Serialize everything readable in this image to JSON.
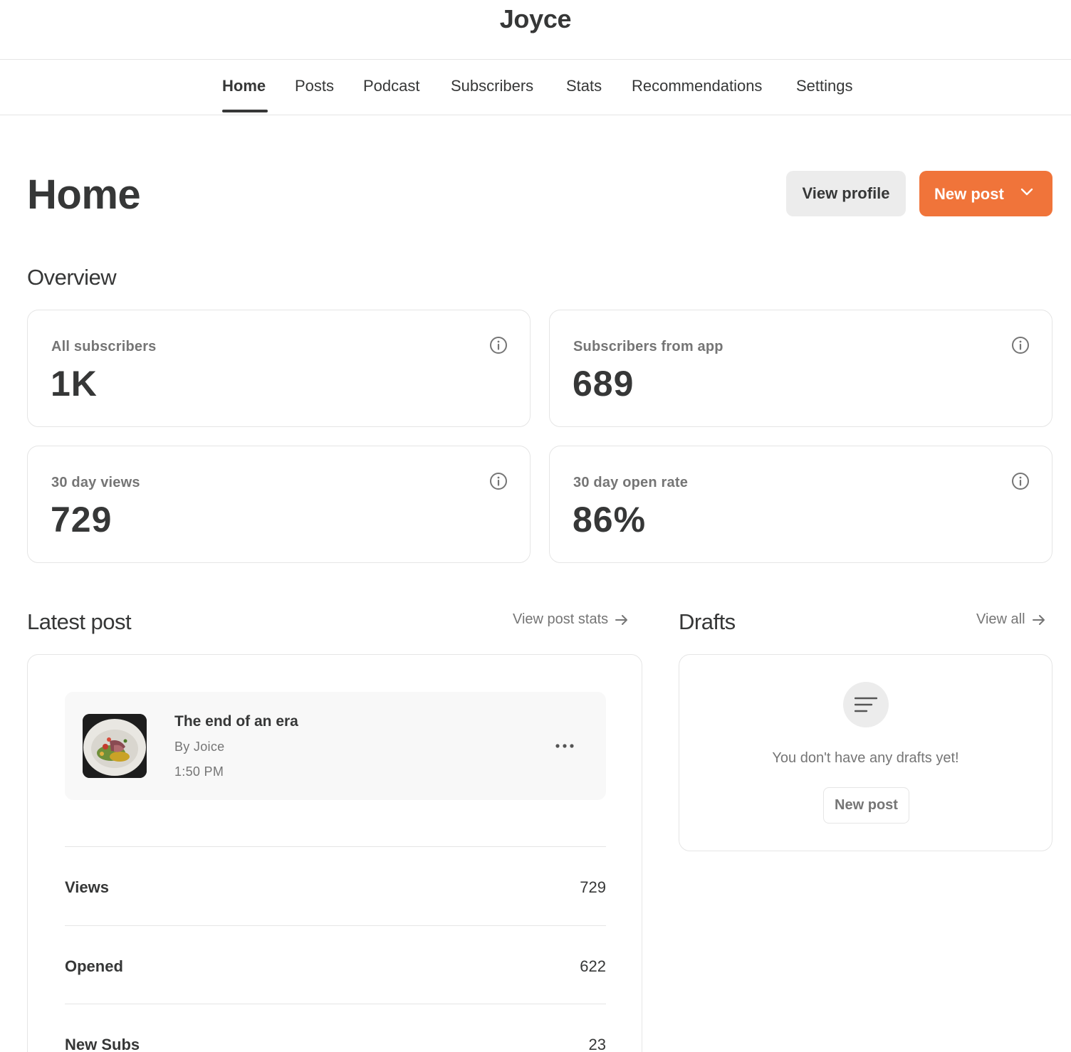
{
  "site": {
    "title": "Joyce"
  },
  "nav": {
    "items": [
      {
        "label": "Home",
        "active": true
      },
      {
        "label": "Posts"
      },
      {
        "label": "Podcast"
      },
      {
        "label": "Subscribers"
      },
      {
        "label": "Stats"
      },
      {
        "label": "Recommendations"
      },
      {
        "label": "Settings"
      }
    ]
  },
  "page": {
    "title": "Home",
    "view_profile_label": "View profile",
    "new_post_label": "New post",
    "accent_color": "#f0743a"
  },
  "overview": {
    "title": "Overview",
    "cards": [
      {
        "label": "All subscribers",
        "value": "1K",
        "icon": "info-icon"
      },
      {
        "label": "Subscribers from app",
        "value": "689",
        "icon": "info-icon"
      },
      {
        "label": "30 day views",
        "value": "729",
        "icon": "info-icon"
      },
      {
        "label": "30 day open rate",
        "value": "86%",
        "icon": "info-icon"
      }
    ]
  },
  "latest_post": {
    "title": "Latest post",
    "link_label": "View post stats",
    "post": {
      "title": "The end of an era",
      "author": "By Joice",
      "time": "1:50 PM",
      "thumbnail": "food-plate-image"
    },
    "stats": [
      {
        "label": "Views",
        "value": "729"
      },
      {
        "label": "Opened",
        "value": "622"
      },
      {
        "label": "New Subs",
        "value": "23"
      }
    ]
  },
  "drafts": {
    "title": "Drafts",
    "link_label": "View all",
    "empty_text": "You don't have any drafts yet!",
    "button_label": "New post",
    "icon": "text-lines-icon"
  }
}
